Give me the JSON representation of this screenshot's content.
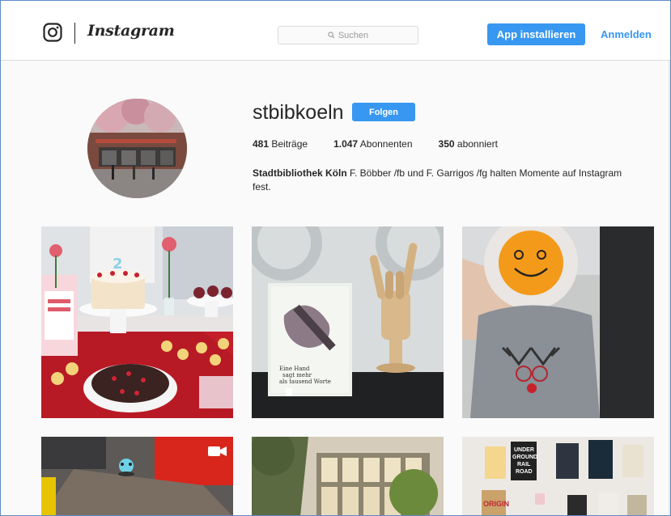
{
  "header": {
    "wordmark": "Instagram",
    "search_placeholder": "Suchen",
    "app_button": "App installieren",
    "login_link": "Anmelden",
    "logo_icon": "instagram-camera-icon"
  },
  "profile": {
    "username": "stbibkoeln",
    "follow_button": "Folgen",
    "stats": [
      {
        "count": "481",
        "label": "Beiträge"
      },
      {
        "count": "1.047",
        "label": "Abonnenten"
      },
      {
        "count": "350",
        "label": "abonniert"
      }
    ],
    "bio_name": "Stadtbibliothek Köln",
    "bio_text": " F. Böbber /fb und F. Garrigos /fg halten Momente auf Instagram fest."
  },
  "posts": [
    {
      "description_icon": "birthday-cakes-photo"
    },
    {
      "description_icon": "wooden-hand-book-photo",
      "book_text": "Eine Hand sagt mehr als tausend Worte"
    },
    {
      "description_icon": "orange-smiley-photo"
    },
    {
      "description_icon": "robot-toy-video",
      "video_icon": "video-camera-icon"
    },
    {
      "description_icon": "library-building-photo"
    },
    {
      "description_icon": "book-display-photo",
      "book_titles": [
        "UNDER GROUND RAIL ROAD",
        "ORIGIN"
      ]
    }
  ],
  "colors": {
    "accent": "#3897f0",
    "text": "#262626",
    "border": "#dbdbdb",
    "background": "#fafafa"
  }
}
